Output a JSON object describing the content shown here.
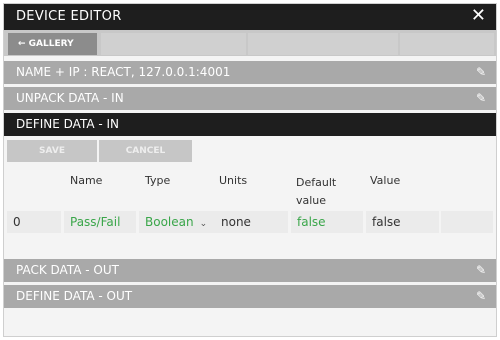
{
  "titlebar": {
    "title": "DEVICE EDITOR",
    "close_icon": "close-icon"
  },
  "nav": {
    "gallery_label": "← GALLERY"
  },
  "sections": {
    "name_ip": "NAME + IP : REACT, 127.0.0.1:4001",
    "unpack": "UNPACK DATA - IN",
    "define_in": "DEFINE DATA - IN",
    "pack": "PACK DATA - OUT",
    "define_out": "DEFINE DATA - OUT"
  },
  "buttons": {
    "save": "SAVE",
    "cancel": "CANCEL"
  },
  "table": {
    "headers": {
      "name": "Name",
      "type": "Type",
      "units": "Units",
      "default": "Default value",
      "value": "Value"
    },
    "rows": [
      {
        "index": "0",
        "name": "Pass/Fail",
        "type": "Boolean",
        "units": "none",
        "default": "false",
        "value": "false"
      }
    ]
  },
  "colors": {
    "accent_green": "#3aa64a",
    "titlebar": "#1e1e1e",
    "section": "#a9a9a9"
  }
}
